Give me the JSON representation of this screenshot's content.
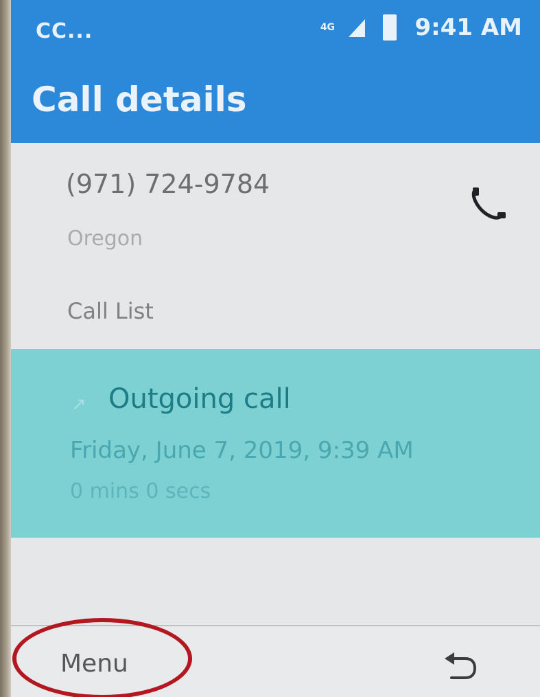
{
  "status_bar": {
    "carrier": "CC...",
    "network": "4G",
    "time": "9:41 AM",
    "icons": [
      "network-4g-icon",
      "signal-icon",
      "battery-icon"
    ]
  },
  "header": {
    "title": "Call details"
  },
  "contact": {
    "phone_number": "(971) 724-9784",
    "location": "Oregon",
    "call_icon": "phone-icon"
  },
  "call_list": {
    "label": "Call List",
    "entries": [
      {
        "direction_icon": "outgoing-arrow-icon",
        "direction_glyph": "↗",
        "type": "Outgoing call",
        "datetime": "Friday, June 7, 2019, 9:39 AM",
        "duration": "0 mins 0 secs"
      }
    ]
  },
  "softkeys": {
    "left_label": "Menu",
    "right_icon": "back-icon"
  },
  "colors": {
    "header_bg": "#2c88d9",
    "selected_row_bg": "#7dd1d2",
    "selected_text": "#1d7d86",
    "annotation_ring": "#b3171f"
  }
}
